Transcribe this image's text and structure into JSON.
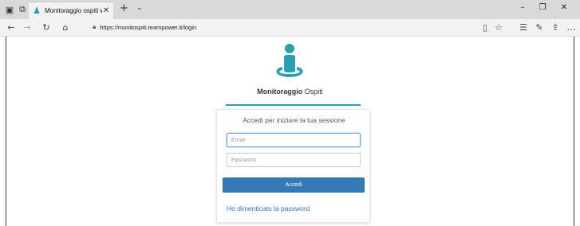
{
  "browser": {
    "tab_title": "Monitoraggio ospiti wel",
    "url": "https://monitospiti.teampower.it/login"
  },
  "app": {
    "name_bold": "Monitoraggio",
    "name_rest": " Ospiti"
  },
  "login": {
    "title": "Accedi per iniziare la tua sessione",
    "email_placeholder": "Email",
    "password_placeholder": "Password",
    "submit_label": "Accedi",
    "forgot_link": "Ho dimenticato la password"
  },
  "colors": {
    "accent": "#2a9fb3",
    "button": "#337ab7",
    "link": "#2f74c0"
  },
  "icons": {
    "logo": "person-on-ring-icon"
  }
}
